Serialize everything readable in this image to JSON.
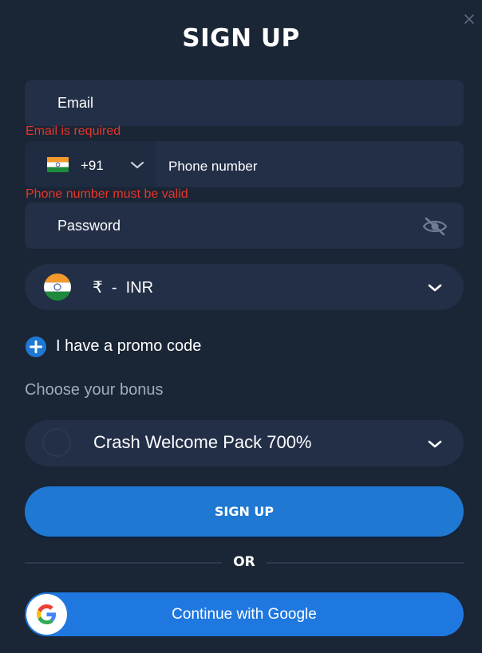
{
  "header": {
    "title": "SIGN UP",
    "close_icon": "close-icon"
  },
  "form": {
    "email": {
      "placeholder": "Email",
      "error": "Email is required"
    },
    "phone": {
      "country_flag": "india-flag-icon",
      "dial_code": "+91",
      "placeholder": "Phone number",
      "error": "Phone number must be valid"
    },
    "password": {
      "placeholder": "Password",
      "visibility_icon": "eye-off-icon"
    },
    "currency": {
      "flag": "india-flag-icon",
      "symbol": "₹",
      "separator": "-",
      "code": "INR"
    },
    "promo": {
      "label": "I have a promo code",
      "icon": "plus-circle-icon"
    },
    "bonus": {
      "heading": "Choose your bonus",
      "selected": "Crash Welcome Pack 700%"
    }
  },
  "actions": {
    "signup_label": "SIGN UP",
    "divider_text": "OR",
    "google_label": "Continue with Google"
  },
  "colors": {
    "background": "#1a2535",
    "field": "#222f47",
    "error": "#e7352a",
    "primary": "#1f78d1",
    "muted_text": "#a3abb9"
  }
}
